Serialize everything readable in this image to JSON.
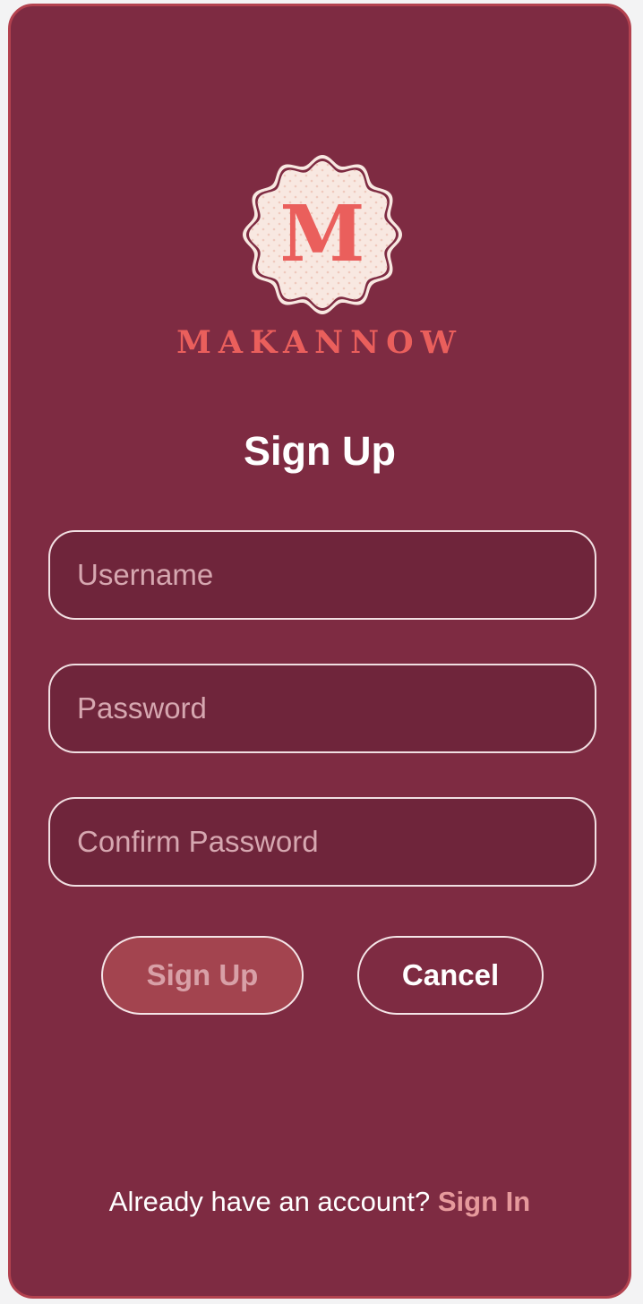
{
  "brand": {
    "monogram": "M",
    "wordmark": "MAKANNOW"
  },
  "page": {
    "title": "Sign Up"
  },
  "form": {
    "username_placeholder": "Username",
    "password_placeholder": "Password",
    "confirm_placeholder": "Confirm Password",
    "username_value": "",
    "password_value": "",
    "confirm_value": ""
  },
  "actions": {
    "signup_label": "Sign Up",
    "cancel_label": "Cancel"
  },
  "footer": {
    "prompt": "Already have an account?",
    "signin_label": "Sign In"
  },
  "colors": {
    "card_background": "#7e2b42",
    "card_border": "#b3424f",
    "field_background": "#6f253b",
    "brand_accent": "#ea5f5c",
    "badge_fill": "#f8e8e1",
    "signup_button": "#a3444f",
    "link": "#e69a9c"
  },
  "icons": {
    "logo": "scalloped-badge-monogram"
  }
}
